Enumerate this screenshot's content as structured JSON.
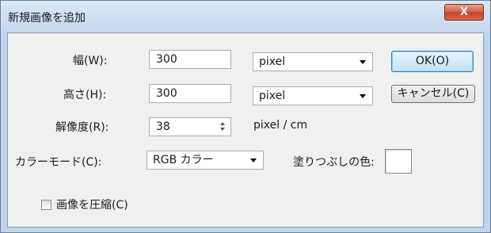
{
  "dialog": {
    "title": "新規画像を追加",
    "close_glyph": "X"
  },
  "width": {
    "label": "幅(W):",
    "value": "300",
    "unit": "pixel"
  },
  "height": {
    "label": "高さ(H):",
    "value": "300",
    "unit": "pixel"
  },
  "resolution": {
    "label": "解像度(R):",
    "value": "38",
    "unit": "pixel / cm"
  },
  "color_mode": {
    "label": "カラーモード(C):",
    "value": "RGB カラー"
  },
  "fill_color": {
    "label": "塗りつぶしの色:",
    "color": "#ffffff"
  },
  "compress": {
    "label": "画像を圧縮(C)",
    "checked": false
  },
  "buttons": {
    "ok_label": "OK(O)",
    "cancel_label": "キャンセル(C)"
  }
}
